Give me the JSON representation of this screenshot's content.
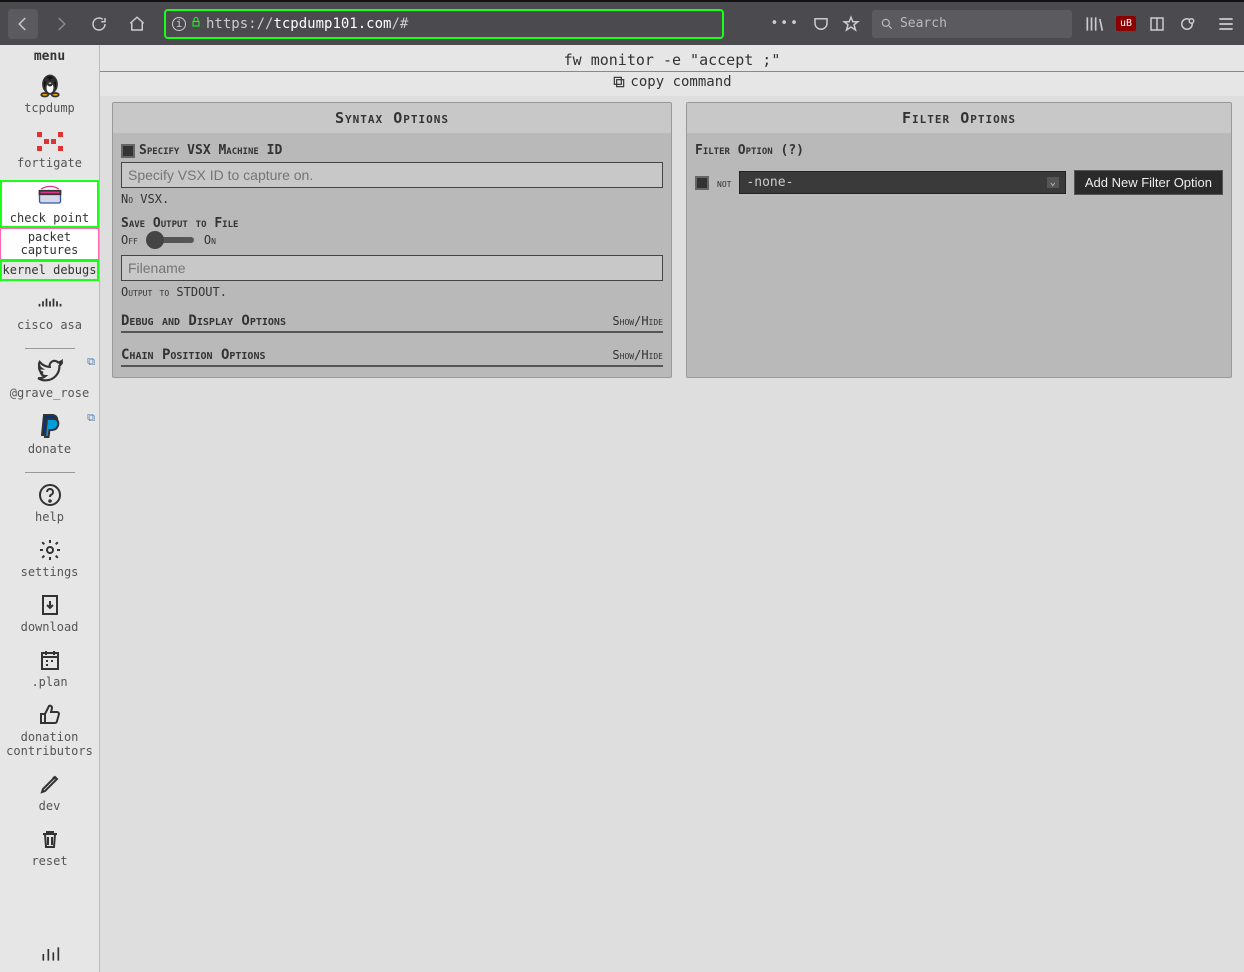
{
  "browser": {
    "url_prefix": "https://",
    "url_domain": "tcpdump101.com",
    "url_path": "/#",
    "search_placeholder": "Search"
  },
  "sidebar": {
    "title": "menu",
    "items": [
      {
        "label": "tcpdump"
      },
      {
        "label": "fortigate"
      },
      {
        "label": "check point",
        "sub": [
          "packet captures",
          "kernel debugs"
        ]
      },
      {
        "label": "cisco asa"
      }
    ],
    "social": [
      {
        "label": "@grave_rose"
      },
      {
        "label": "donate"
      }
    ],
    "tools": [
      {
        "label": "help"
      },
      {
        "label": "settings"
      },
      {
        "label": "download"
      },
      {
        "label": ".plan"
      },
      {
        "label": "donation contributors"
      },
      {
        "label": "dev"
      },
      {
        "label": "reset"
      }
    ]
  },
  "command": "fw monitor -e \"accept ;\"",
  "copy_label": "copy command",
  "syntax": {
    "title": "Syntax Options",
    "vsx_label": "Specify VSX Machine ID",
    "vsx_placeholder": "Specify VSX ID to capture on.",
    "vsx_hint": "No VSX.",
    "save_label": "Save Output to File",
    "off": "Off",
    "on": "On",
    "filename_placeholder": "Filename",
    "output_hint": "Output to STDOUT.",
    "section1": "Debug and Display Options",
    "section2": "Chain Position Options",
    "showhide": "Show/Hide"
  },
  "filter": {
    "title": "Filter Options",
    "option_label": "Filter Option (?)",
    "not_label": "not",
    "dropdown_value": "-none-",
    "add_button": "Add New Filter Option"
  }
}
